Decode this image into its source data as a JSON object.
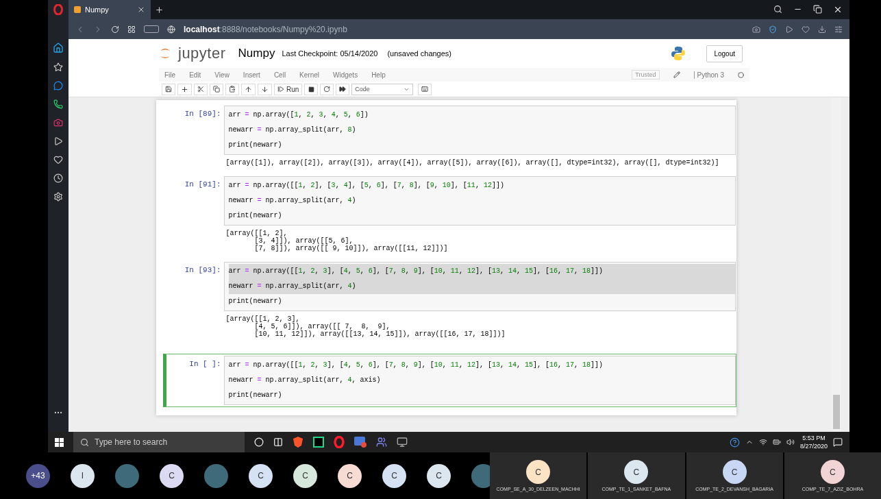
{
  "browser": {
    "tab_title": "Numpy",
    "url": "**localhost**:8888/notebooks/Numpy%20.ipynb"
  },
  "jupyter": {
    "logo_text": "jupyter",
    "notebook_name": "Numpy",
    "checkpoint": "Last Checkpoint: 05/14/2020",
    "status": "(unsaved changes)",
    "logout": "Logout",
    "menu": [
      "File",
      "Edit",
      "View",
      "Insert",
      "Cell",
      "Kernel",
      "Widgets",
      "Help"
    ],
    "trusted": "Trusted",
    "kernel": "Python 3",
    "run": "Run",
    "cell_type": "Code"
  },
  "cells": [
    {
      "prompt": "In [89]:",
      "selected": false,
      "highlighted": false,
      "input": [
        "arr = np.array([1, 2, 3, 4, 5, 6])",
        "newarr = np.array_split(arr, 8)",
        "print(newarr)"
      ],
      "output": [
        "[array([1]), array([2]), array([3]), array([4]), array([5]), array([6]), array([], dtype=int32), array([], dtype=int32)]"
      ]
    },
    {
      "prompt": "In [91]:",
      "selected": false,
      "highlighted": false,
      "input": [
        "arr = np.array([[1, 2], [3, 4], [5, 6], [7, 8], [9, 10], [11, 12]])",
        "newarr = np.array_split(arr, 4)",
        "print(newarr)"
      ],
      "output": [
        "[array([[1, 2],",
        "       [3, 4]]), array([[5, 6],",
        "       [7, 8]]), array([[ 9, 10]]), array([[11, 12]])]"
      ]
    },
    {
      "prompt": "In [93]:",
      "selected": false,
      "highlighted": true,
      "input": [
        "arr = np.array([[1, 2, 3], [4, 5, 6], [7, 8, 9], [10, 11, 12], [13, 14, 15], [16, 17, 18]])",
        "newarr = np.array_split(arr, 4)",
        "print(newarr)"
      ],
      "output": [
        "[array([[1, 2, 3],",
        "       [4, 5, 6]]), array([[ 7,  8,  9],",
        "       [10, 11, 12]]), array([[13, 14, 15]]), array([[16, 17, 18]])]"
      ]
    },
    {
      "prompt": "In [ ]:",
      "selected": true,
      "highlighted": false,
      "input": [
        "arr = np.array([[1, 2, 3], [4, 5, 6], [7, 8, 9], [10, 11, 12], [13, 14, 15], [16, 17, 18]])",
        "newarr = np.array_split(arr, 4, axis)",
        "print(newarr)"
      ]
    }
  ],
  "taskbar": {
    "search_placeholder": "Type here to search",
    "time": "5:53 PM",
    "date": "8/27/2020"
  },
  "participants": [
    {
      "kind": "count",
      "label": "+43"
    },
    {
      "kind": "initial",
      "label": "I",
      "color": "#dce6ee"
    },
    {
      "kind": "photo"
    },
    {
      "kind": "initial",
      "label": "C",
      "color": "#dcdaf2"
    },
    {
      "kind": "photo"
    },
    {
      "kind": "initial",
      "label": "C",
      "color": "#d4e2f4"
    },
    {
      "kind": "initial",
      "label": "C",
      "color": "#d6e8dc"
    },
    {
      "kind": "initial",
      "label": "C",
      "color": "#f8dcd4"
    },
    {
      "kind": "initial",
      "label": "C",
      "color": "#d4e2f4"
    },
    {
      "kind": "initial",
      "label": "C",
      "color": "#dce6ee"
    },
    {
      "kind": "photo"
    }
  ],
  "tiles": [
    {
      "label": "C",
      "color": "#fbe3c4",
      "name": "COMP_SE_A_30_DELZEEN_MACHHI"
    },
    {
      "label": "C",
      "color": "#dce6ee",
      "name": "COMP_TE_1_SANKET_BAFNA"
    },
    {
      "label": "C",
      "color": "#c8d8f4",
      "name": "COMP_TE_2_DEVANSH_BAGARIA"
    },
    {
      "label": "C",
      "color": "#f2d4d4",
      "name": "COMP_TE_7_AZIZ_BOHRA"
    }
  ]
}
